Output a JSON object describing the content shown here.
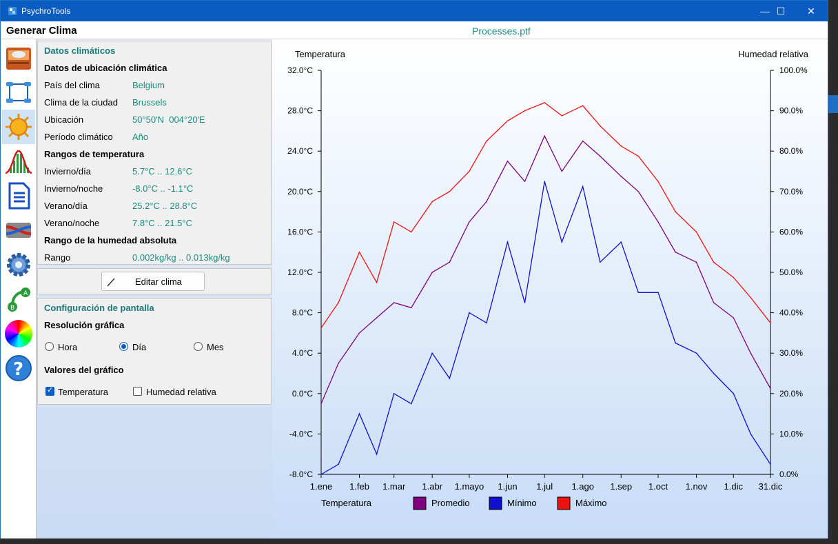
{
  "window": {
    "app_title": "PsychroTools",
    "minimize": "—",
    "maximize": "☐",
    "close": "✕"
  },
  "menubar": {
    "title": "Generar Clima",
    "file_name": "Processes.ptf"
  },
  "toolbar": {
    "items": [
      "climate-folder-icon",
      "process-flow-icon",
      "sun-icon",
      "distribution-icon",
      "document-icon",
      "heat-exchanger-icon",
      "gear-icon",
      "ab-cycle-icon",
      "color-wheel-icon",
      "help-icon"
    ],
    "active": "sun-icon"
  },
  "climate": {
    "header": "Datos climáticos",
    "location_title": "Datos de ubicación climática",
    "country_label": "País del clima",
    "country": "Belgium",
    "city_label": "Clima de la ciudad",
    "city": "Brussels",
    "location_label": "Ubicación",
    "location": "50°50'N  004°20'E",
    "period_label": "Período climático",
    "period": "Año",
    "temp_ranges_title": "Rangos de temperatura",
    "winter_day_label": "Invierno/día",
    "winter_day": "5.7°C .. 12.6°C",
    "winter_night_label": "Invierno/noche",
    "winter_night": "-8.0°C .. -1.1°C",
    "summer_day_label": "Verano/día",
    "summer_day": "25.2°C .. 28.8°C",
    "summer_night_label": "Verano/noche",
    "summer_night": "7.8°C .. 21.5°C",
    "humidity_title": "Rango de la humedad absoluta",
    "range_label": "Rango",
    "range": "0.002kg/kg .. 0.013kg/kg"
  },
  "edit_button": "Editar clima",
  "display": {
    "header": "Configuración de pantalla",
    "resolution_title": "Resolución gráfica",
    "opt_hour": "Hora",
    "opt_day": "Día",
    "opt_month": "Mes",
    "selected": "Día",
    "values_title": "Valores del gráfico",
    "chk_temp": "Temperatura",
    "chk_temp_on": true,
    "chk_hum": "Humedad relativa",
    "chk_hum_on": false
  },
  "colors": {
    "average": "#800080",
    "minimum": "#1010d0",
    "maximum": "#ee1111"
  },
  "chart_data": {
    "type": "line",
    "ylabel_left": "Temperatura",
    "ylabel_right": "Humedad relativa",
    "y_ticks": [
      "32.0°C",
      "28.0°C",
      "24.0°C",
      "20.0°C",
      "16.0°C",
      "12.0°C",
      "8.0°C",
      "4.0°C",
      "0.0°C",
      "-4.0°C",
      "-8.0°C"
    ],
    "y2_ticks": [
      "100.0%",
      "90.0%",
      "80.0%",
      "70.0%",
      "60.0%",
      "50.0%",
      "40.0%",
      "30.0%",
      "20.0%",
      "10.0%",
      "0.0%"
    ],
    "ylim": [
      -8,
      32
    ],
    "y2lim": [
      0,
      100
    ],
    "x_ticks": [
      "1.ene",
      "1.feb",
      "1.mar",
      "1.abr",
      "1.mayo",
      "1.jun",
      "1.jul",
      "1.ago",
      "1.sep",
      "1.oct",
      "1.nov",
      "1.dic",
      "31.dic"
    ],
    "x_tick_days": [
      1,
      32,
      60,
      91,
      121,
      152,
      182,
      213,
      244,
      274,
      305,
      335,
      365
    ],
    "legend_title": "Temperatura",
    "x_days": [
      1,
      15,
      32,
      46,
      60,
      74,
      91,
      105,
      121,
      135,
      152,
      166,
      182,
      196,
      213,
      227,
      244,
      258,
      274,
      288,
      305,
      319,
      335,
      349,
      365
    ],
    "series": [
      {
        "name": "Promedio",
        "values": [
          -1.0,
          3.0,
          6.0,
          7.5,
          9.0,
          8.5,
          12.0,
          13.0,
          17.0,
          19.0,
          23.0,
          21.0,
          25.5,
          22.0,
          25.0,
          23.5,
          21.5,
          20.0,
          17.0,
          14.0,
          13.0,
          9.0,
          7.5,
          4.0,
          0.5
        ]
      },
      {
        "name": "Mínimo",
        "values": [
          -8.0,
          -7.0,
          -2.0,
          -6.0,
          0.0,
          -1.0,
          4.0,
          1.5,
          8.0,
          7.0,
          15.0,
          9.0,
          21.0,
          15.0,
          20.5,
          13.0,
          15.0,
          10.0,
          10.0,
          5.0,
          4.0,
          2.0,
          0.0,
          -4.0,
          -7.0
        ]
      },
      {
        "name": "Máximo",
        "values": [
          6.5,
          9.0,
          14.0,
          11.0,
          17.0,
          16.0,
          19.0,
          20.0,
          22.0,
          25.0,
          27.0,
          28.0,
          28.8,
          27.5,
          28.5,
          26.5,
          24.5,
          23.5,
          21.0,
          18.0,
          16.0,
          13.0,
          11.5,
          9.5,
          7.0
        ]
      }
    ]
  }
}
